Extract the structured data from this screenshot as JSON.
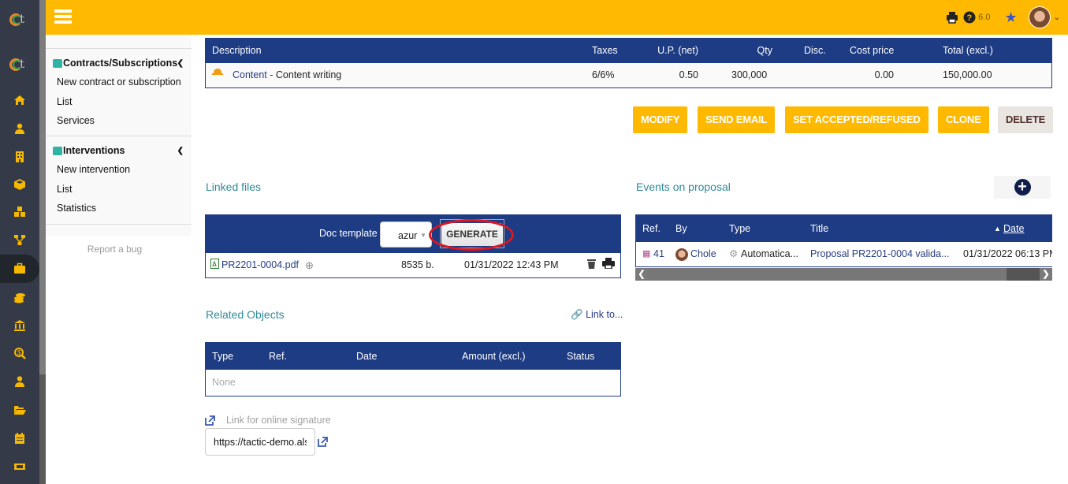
{
  "topbar": {
    "version": "6.0",
    "icons": [
      "menu-icon",
      "print-icon",
      "help-icon",
      "star-icon",
      "user-avatar",
      "chevron-down-icon"
    ]
  },
  "rail": {
    "icons": [
      "logo",
      "logo",
      "home-icon",
      "user-icon",
      "building-icon",
      "cube-icon",
      "cubes-icon",
      "sitemap-icon",
      "briefcase-icon",
      "coins-icon",
      "bank-icon",
      "search-dollar-icon",
      "user-tie-icon",
      "folder-open-icon",
      "calendar-icon",
      "ticket-icon"
    ],
    "active": "briefcase-icon"
  },
  "menu": {
    "cut_item": "Statistics",
    "groups": [
      {
        "title": "Contracts/Subscriptions",
        "items": [
          "New contract or subscription",
          "List",
          "Services"
        ]
      },
      {
        "title": "Interventions",
        "items": [
          "New intervention",
          "List",
          "Statistics"
        ]
      }
    ],
    "report_bug": "Report a bug"
  },
  "lines_table": {
    "headers": [
      "Description",
      "Taxes",
      "U.P. (net)",
      "Qty",
      "Disc.",
      "Cost price",
      "Total (excl.)"
    ],
    "rows": [
      {
        "product": "Content",
        "description": " - Content writing",
        "taxes": "6/6%",
        "up_net": "0.50",
        "qty": "300,000",
        "disc": "",
        "cost_price": "0.00",
        "total": "150,000.00"
      }
    ]
  },
  "actions": {
    "modify": "MODIFY",
    "send_email": "SEND EMAIL",
    "set_accepted": "SET ACCEPTED/REFUSED",
    "clone": "CLONE",
    "delete": "DELETE"
  },
  "linked_files": {
    "title": "Linked files",
    "doc_template_label": "Doc template",
    "template_value": "azur",
    "generate": "GENERATE",
    "files": [
      {
        "name": "PR2201-0004.pdf",
        "size": "8535 b.",
        "date": "01/31/2022 12:43 PM"
      }
    ]
  },
  "events": {
    "title": "Events on proposal",
    "headers": [
      "Ref.",
      "By",
      "Type",
      "Title",
      "Date"
    ],
    "sort_column": "Date",
    "rows": [
      {
        "ref": "41",
        "by": "Chole",
        "type": "Automatica...",
        "title": "Proposal PR2201-0004 valida...",
        "date": "01/31/2022 06:13 PM"
      }
    ]
  },
  "related_objects": {
    "title": "Related Objects",
    "link_to": "Link to...",
    "headers": [
      "Type",
      "Ref.",
      "Date",
      "Amount (excl.)",
      "Status"
    ],
    "empty": "None"
  },
  "signature": {
    "label": "Link for online signature",
    "url": "https://tactic-demo.als"
  },
  "colors": {
    "accent": "#ffb900",
    "header_blue": "#1e3c84",
    "section_title": "#2f8a99",
    "rail_bg": "#343a47",
    "highlight_red": "#e0161f"
  }
}
